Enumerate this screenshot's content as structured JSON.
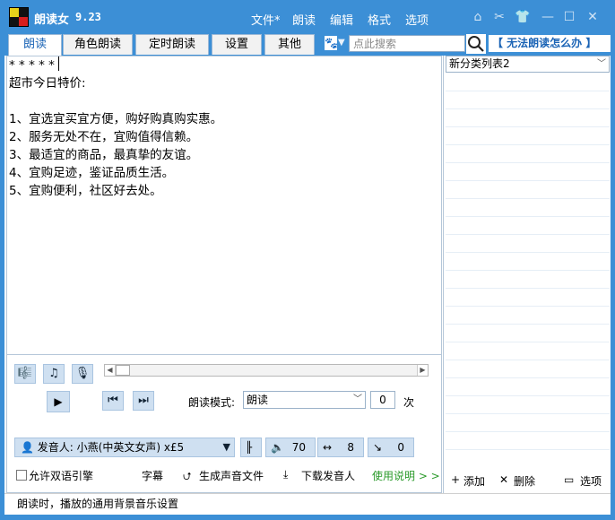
{
  "app": {
    "title": "朗读女",
    "version": "9.23"
  },
  "menu": [
    "文件*",
    "朗读",
    "编辑",
    "格式",
    "选项"
  ],
  "window_icons": [
    "home-icon",
    "tools-icon",
    "shirt-icon",
    "minimize-icon",
    "maximize-icon",
    "close-icon"
  ],
  "tabs": [
    "朗读",
    "角色朗读",
    "定时朗读",
    "设置",
    "其他"
  ],
  "search": {
    "placeholder": "点此搜索"
  },
  "help_link": "【 无法朗读怎么办 】",
  "editor": {
    "lines": [
      "* * * * * ",
      "超市今日特价:",
      "",
      "1、宜选宜买宜方便，购好购真购实惠。",
      "2、服务无处不在，宜购值得信赖。",
      "3、最适宜的商品，最真挚的友谊。",
      "4、宜购足迹，鉴证品质生活。",
      "5、宜购便利，社区好去处。"
    ]
  },
  "category": {
    "selected": "新分类列表2"
  },
  "player": {
    "mode_label": "朗读模式:",
    "mode_value": "朗读",
    "count_value": "0",
    "count_unit": "次",
    "voice": "发音人: 小燕(中英文女声) x£5",
    "volume": "70",
    "speed": "8",
    "pitch": "0"
  },
  "options": {
    "bilingual_label": "允许双语引擎",
    "subtitle": "字幕",
    "generate_audio": "生成声音文件",
    "download_voice": "下载发音人",
    "instructions": "使用说明 > >"
  },
  "list_actions": {
    "add": "添加",
    "delete": "删除",
    "options": "选项"
  },
  "status": "朗读时，播放的通用背景音乐设置",
  "colors": {
    "titlebar": "#3c8fd6",
    "button_bg": "#cfe0f1",
    "accent_link": "#1a63b5",
    "green": "#2a9a2a"
  }
}
